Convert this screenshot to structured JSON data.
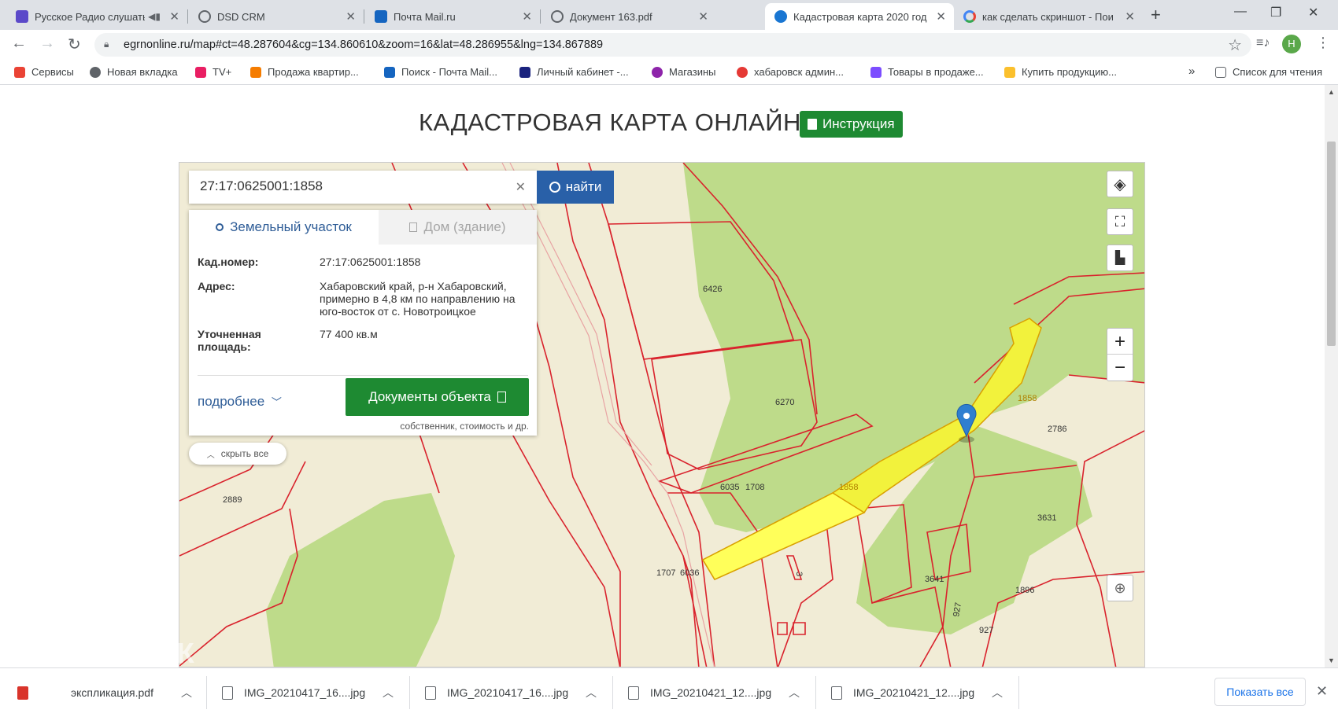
{
  "browser": {
    "tabs": [
      {
        "title": "Русское Радио слушать",
        "icon_color": "#5b49c9",
        "active": false
      },
      {
        "title": "DSD CRM",
        "icon_color": "#5f6368",
        "active": false
      },
      {
        "title": "Почта Mail.ru",
        "icon_color": "#1565c0",
        "active": false
      },
      {
        "title": "Документ 163.pdf",
        "icon_color": "#5f6368",
        "active": false
      },
      {
        "title": "Кадастровая карта 2020 год",
        "icon_color": "#1976d2",
        "active": true
      },
      {
        "title": "как сделать скриншот - Пои",
        "icon_color": "#4285f4",
        "active": false
      }
    ],
    "tab_close": "✕",
    "new_tab": "+",
    "window_buttons": [
      "—",
      "❐",
      "✕"
    ],
    "url": "egrnonline.ru/map#ct=48.287604&cg=134.860610&zoom=16&lat=48.286955&lng=134.867889",
    "avatar_letter": "Н",
    "bookmarks": [
      {
        "label": "Сервисы",
        "color": "#ea4335"
      },
      {
        "label": "Новая вкладка",
        "color": "#5f6368"
      },
      {
        "label": "TV+",
        "color": "#e91e63"
      },
      {
        "label": "Продажа квартир...",
        "color": "#f57c00"
      },
      {
        "label": "Поиск - Почта Mail...",
        "color": "#1565c0"
      },
      {
        "label": "Личный кабинет -...",
        "color": "#1a237e"
      },
      {
        "label": "Магазины",
        "color": "#8e24aa"
      },
      {
        "label": "хабаровск админ...",
        "color": "#e53935"
      },
      {
        "label": "Товары в продаже...",
        "color": "#7c4dff"
      },
      {
        "label": "Купить продукцию...",
        "color": "#fbc02d"
      }
    ],
    "bookmarks_more": "»",
    "reading_list": "Список для чтения"
  },
  "page": {
    "title": "КАДАСТРОВАЯ КАРТА ОНЛАЙН",
    "instruction_button": "Инструкция"
  },
  "search": {
    "value": "27:17:0625001:1858",
    "clear": "✕",
    "button": "найти"
  },
  "panel": {
    "tab_land": "Земельный участок",
    "tab_house": "Дом (здание)",
    "cad_label": "Кад.номер:",
    "cad_value": "27:17:0625001:1858",
    "address_label": "Адрес:",
    "address_value": "Хабаровский край, р-н Хабаровский, примерно в 4,8 км по направлению на юго-восток от с. Новотроицкое",
    "area_label": "Уточненная площадь:",
    "area_value": "77 400 кв.м",
    "more": "подробнее",
    "docs_button": "Документы объекта",
    "docs_sub": "собственник, стоимость и др.",
    "hide_all": "скрыть все"
  },
  "map_labels": [
    {
      "text": "6426"
    },
    {
      "text": "6270"
    },
    {
      "text": "6035"
    },
    {
      "text": "1708"
    },
    {
      "text": "1858"
    },
    {
      "text": "1858"
    },
    {
      "text": "2786"
    },
    {
      "text": "3631"
    },
    {
      "text": "2889"
    },
    {
      "text": "1707"
    },
    {
      "text": "6036"
    },
    {
      "text": "3641"
    },
    {
      "text": "1896"
    },
    {
      "text": "927"
    },
    {
      "text": "927"
    },
    {
      "text": "3"
    }
  ],
  "map_controls": {
    "zoom_in": "+",
    "zoom_out": "−"
  },
  "downloads": {
    "items": [
      {
        "name": "экспликация.pdf",
        "type": "pdf"
      },
      {
        "name": "IMG_20210417_16....jpg",
        "type": "img"
      },
      {
        "name": "IMG_20210417_16....jpg",
        "type": "img"
      },
      {
        "name": "IMG_20210421_12....jpg",
        "type": "img"
      },
      {
        "name": "IMG_20210421_12....jpg",
        "type": "img"
      }
    ],
    "show_all": "Показать все",
    "close": "✕"
  },
  "watermark": "ДОМКЛИК",
  "colors": {
    "map_base": "#f1ecd6",
    "forest": "#bedb8a",
    "parcel_border": "#d9232d",
    "highlight": "#ffff3c",
    "accent_green": "#1e8a32",
    "accent_blue": "#2960a8"
  }
}
